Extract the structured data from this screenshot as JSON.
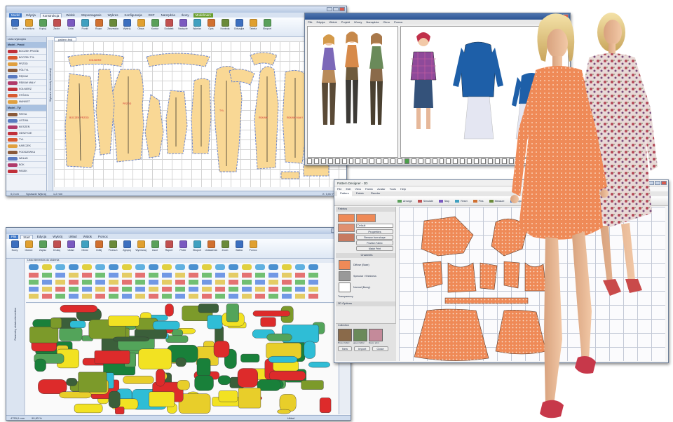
{
  "win1": {
    "app_tabs": [
      "Model",
      "Edycja",
      "Konstrukcja",
      "Widok",
      "Wspomaganie",
      "Wykres",
      "Konfiguracja",
      "DXF",
      "Narzędzia",
      "Ikony",
      "Modelmani"
    ],
    "ribbon_buttons": [
      "Szkic",
      "z szablonu",
      "Kopiuj",
      "Zaokr.",
      "Linia",
      "Punkt",
      "Rozpr.",
      "Zaszewka",
      "Wykrój",
      "Obrys",
      "Kontur",
      "Dodatek",
      "Nacięcie",
      "Wymiar",
      "Opis",
      "Kontrola",
      "Odszyjka",
      "Tabela",
      "Eksport"
    ],
    "panel_tab": "Lista wykrojów",
    "doc_tab": "pattern.fmd",
    "sections": [
      "Model - Przód",
      "Model - Tył"
    ],
    "piece_labels": [
      "BOCZEK PRZÓD",
      "BOCZEK TYŁ",
      "PRZÓD",
      "PÓŁTYŁ",
      "RĘKAW",
      "RĘKAW MAŁY",
      "KOŁNIERZ",
      "STÓJKA",
      "MANKIET",
      "PATKA",
      "LISTWA",
      "KIESZEŃ",
      "ODSZYCIE",
      "TYŁ",
      "KARCZEK",
      "PODSZEWKA",
      "WKŁAD",
      "BOK",
      "PASEK"
    ],
    "status": [
      "0,0 cm",
      "Sprawdź Wykrój",
      "1,2 mm",
      "X: 0,00  Y: 0,00"
    ],
    "vertical_label": "Wybrane elementy konstrukcji"
  },
  "win2": {
    "menu": [
      "Plik",
      "Edycja",
      "Widok",
      "Projekt",
      "Wzory",
      "Narzędzia",
      "Okno",
      "Pomoc"
    ]
  },
  "win3": {
    "app_tabs": [
      "Plik",
      "Start",
      "Edycja",
      "Wykrój",
      "Układ",
      "Widok",
      "Pomoc"
    ],
    "ribbon_buttons": [
      "Nowy",
      "Otwórz",
      "Zapisz",
      "Drukuj",
      "Układ",
      "Obróć",
      "Odbij",
      "Przesuń",
      "Zgrupuj",
      "Wyrównaj",
      "Usuń",
      "Raport",
      "Ploter",
      "Eksport",
      "Ustawienia",
      "Zoom",
      "Siatka",
      "Pomoc"
    ],
    "strip_label": "Lista elementów do ułożenia",
    "vertical_label": "Parametry układu elementów",
    "status": [
      "4753,0 mm",
      "90,83 %",
      "Układ"
    ]
  },
  "win4": {
    "title": "Pattern Designer - 3D",
    "menu": [
      "File",
      "Edit",
      "View",
      "Fabric",
      "Avatar",
      "Tools",
      "Help"
    ],
    "tabs": [
      "Pattern",
      "Fabric",
      "Render"
    ],
    "toolbar": [
      "Arrange",
      "Simulate",
      "Stop",
      "Reset",
      "Pins",
      "Measure",
      "Export"
    ],
    "panel_title": "Fabrics",
    "fabric_input": "Default",
    "fabric_buttons": [
      "Properties",
      "Remove from shape",
      "Position Fabric",
      "Match Print"
    ],
    "channels_title": "Channels",
    "channel_items": [
      "Diffuse (Base)",
      "Specular / Shininess",
      "Normal (Bump)",
      "Transparency"
    ],
    "section_3d": "3D Options",
    "collection_title": "Collection",
    "collection_items": [
      "Brown fabric",
      "green fabric",
      "flower print"
    ],
    "bottom_buttons": [
      "New",
      "Import",
      "Close"
    ]
  },
  "colors": {
    "ribbon": "#dfe8f4",
    "pattern_fill": "#f9d895",
    "pattern_outline": "#6f86c8",
    "orange_fabric": "#ef8a57",
    "blue_jacket": "#1e5fa8",
    "marker_colors": [
      "#dd2b2b",
      "#f2e222",
      "#7c9a2a",
      "#2fbdd6",
      "#53a45a",
      "#19803a",
      "#e8ce2a",
      "#3b5f3a"
    ]
  },
  "icons": [
    "logo-icon",
    "minimize-icon",
    "maximize-icon",
    "close-icon",
    "pin-icon",
    "folder-icon",
    "save-icon",
    "scissors-icon",
    "ruler-icon",
    "needle-icon"
  ]
}
